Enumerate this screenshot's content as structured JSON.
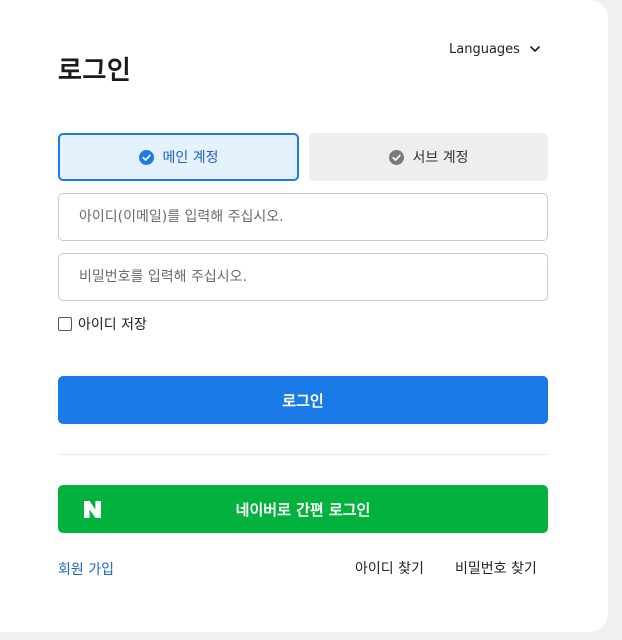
{
  "page": {
    "title": "로그인"
  },
  "language_selector": {
    "label": "Languages",
    "icon": "chevron-down-icon"
  },
  "tabs": [
    {
      "label": "메인 계정",
      "icon": "check-circle-icon",
      "active": true
    },
    {
      "label": "서브 계정",
      "icon": "check-circle-icon",
      "active": false
    }
  ],
  "form": {
    "id_placeholder": "아이디(이메일)를 입력해 주십시오.",
    "id_value": "",
    "password_placeholder": "비밀번호를 입력해 주십시오.",
    "password_value": "",
    "remember_label": "아이디 저장",
    "remember_checked": false
  },
  "login_button_label": "로그인",
  "naver_button": {
    "label": "네이버로 간편 로그인",
    "icon": "naver-n-logo"
  },
  "links": {
    "signup": "회원 가입",
    "find_id": "아이디 찾기",
    "find_password": "비밀번호 찾기"
  },
  "colors": {
    "primary_blue": "#1a7ae8",
    "active_tab_bg": "#e5f1fd",
    "inactive_tab_bg": "#eeeeee",
    "naver_green": "#03b23d",
    "link_blue": "#1f64c7"
  }
}
